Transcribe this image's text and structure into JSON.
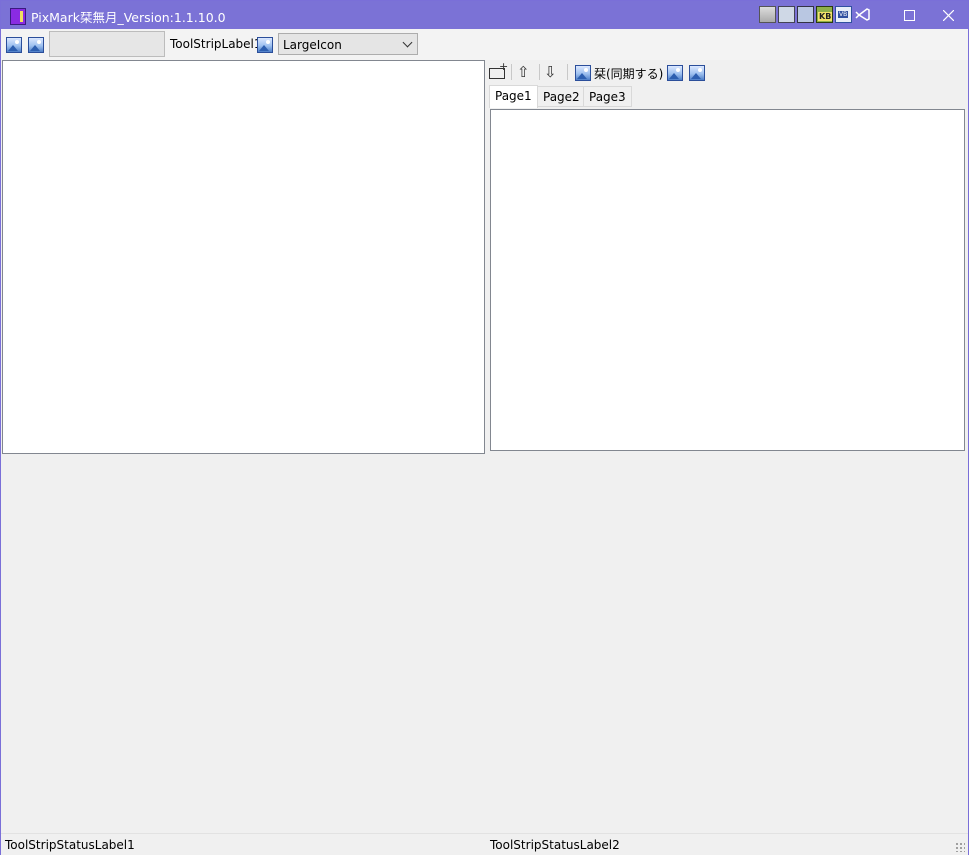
{
  "window": {
    "title": "PixMark栞無月_Version:1.1.10.0",
    "accent_color": "#7b72d6"
  },
  "tray_icons": [
    "film-clapper-icon",
    "excel-icon",
    "mail-icon",
    "kb-icon",
    "vb-icon",
    "visual-studio-icon"
  ],
  "toolbar": {
    "textbox_value": "",
    "label": "ToolStripLabel1",
    "combo_value": "LargeIcon"
  },
  "right_toolbar": {
    "sync_label": "栞(同期する)"
  },
  "tabs": [
    {
      "label": "Page1",
      "active": true
    },
    {
      "label": "Page2",
      "active": false
    },
    {
      "label": "Page3",
      "active": false
    }
  ],
  "status": {
    "left": "ToolStripStatusLabel1",
    "right": "ToolStripStatusLabel2"
  }
}
